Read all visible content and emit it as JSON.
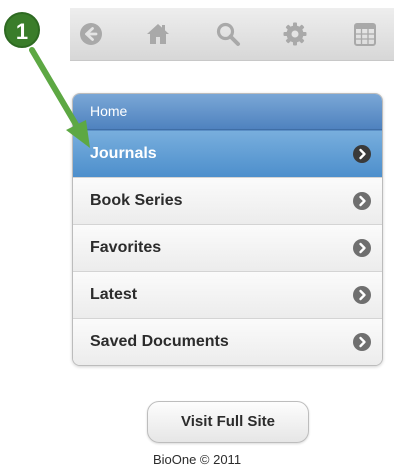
{
  "toolbar": {
    "icons": [
      "back-icon",
      "home-icon",
      "search-icon",
      "settings-icon",
      "calendar-icon"
    ],
    "icon_color": "#a9a9a9"
  },
  "menu": {
    "header": "Home",
    "items": [
      {
        "label": "Journals",
        "active": true
      },
      {
        "label": "Book Series",
        "active": false
      },
      {
        "label": "Favorites",
        "active": false
      },
      {
        "label": "Latest",
        "active": false
      },
      {
        "label": "Saved Documents",
        "active": false
      }
    ],
    "accent_color": "#4f82bf"
  },
  "visit_button": {
    "label": "Visit Full Site"
  },
  "footer": {
    "text": "BioOne © 2011"
  },
  "callout": {
    "number": "1",
    "color": "#3a7d2a"
  }
}
